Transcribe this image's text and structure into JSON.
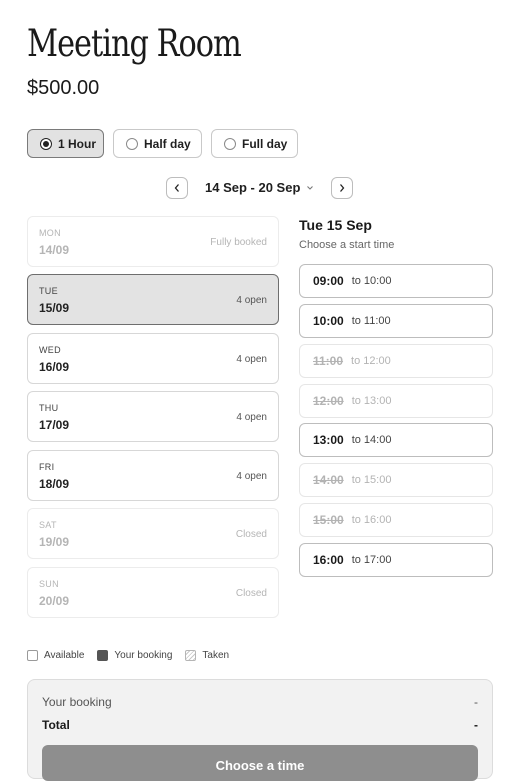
{
  "room": {
    "title": "Meeting Room",
    "price": "$500.00"
  },
  "durations": [
    {
      "label": "1 Hour",
      "selected": true
    },
    {
      "label": "Half day",
      "selected": false
    },
    {
      "label": "Full day",
      "selected": false
    }
  ],
  "week": {
    "range_label": "14 Sep - 20 Sep"
  },
  "days": [
    {
      "name": "MON",
      "date": "14/09",
      "status": "Fully booked",
      "state": "unavailable"
    },
    {
      "name": "TUE",
      "date": "15/09",
      "status": "4 open",
      "state": "selected"
    },
    {
      "name": "WED",
      "date": "16/09",
      "status": "4 open",
      "state": "available"
    },
    {
      "name": "THU",
      "date": "17/09",
      "status": "4 open",
      "state": "available"
    },
    {
      "name": "FRI",
      "date": "18/09",
      "status": "4 open",
      "state": "available"
    },
    {
      "name": "SAT",
      "date": "19/09",
      "status": "Closed",
      "state": "unavailable"
    },
    {
      "name": "SUN",
      "date": "20/09",
      "status": "Closed",
      "state": "unavailable"
    }
  ],
  "selected_day": {
    "title": "Tue 15 Sep",
    "subtitle": "Choose a start time"
  },
  "slots": [
    {
      "start": "09:00",
      "end": "to 10:00",
      "taken": false
    },
    {
      "start": "10:00",
      "end": "to 11:00",
      "taken": false
    },
    {
      "start": "11:00",
      "end": "to 12:00",
      "taken": true
    },
    {
      "start": "12:00",
      "end": "to 13:00",
      "taken": true
    },
    {
      "start": "13:00",
      "end": "to 14:00",
      "taken": false
    },
    {
      "start": "14:00",
      "end": "to 15:00",
      "taken": true
    },
    {
      "start": "15:00",
      "end": "to 16:00",
      "taken": true
    },
    {
      "start": "16:00",
      "end": "to 17:00",
      "taken": false
    }
  ],
  "legend": {
    "available": "Available",
    "your_booking": "Your booking",
    "taken": "Taken"
  },
  "summary": {
    "booking_label": "Your booking",
    "booking_value": "-",
    "total_label": "Total",
    "total_value": "-",
    "cta_label": "Choose a time"
  }
}
